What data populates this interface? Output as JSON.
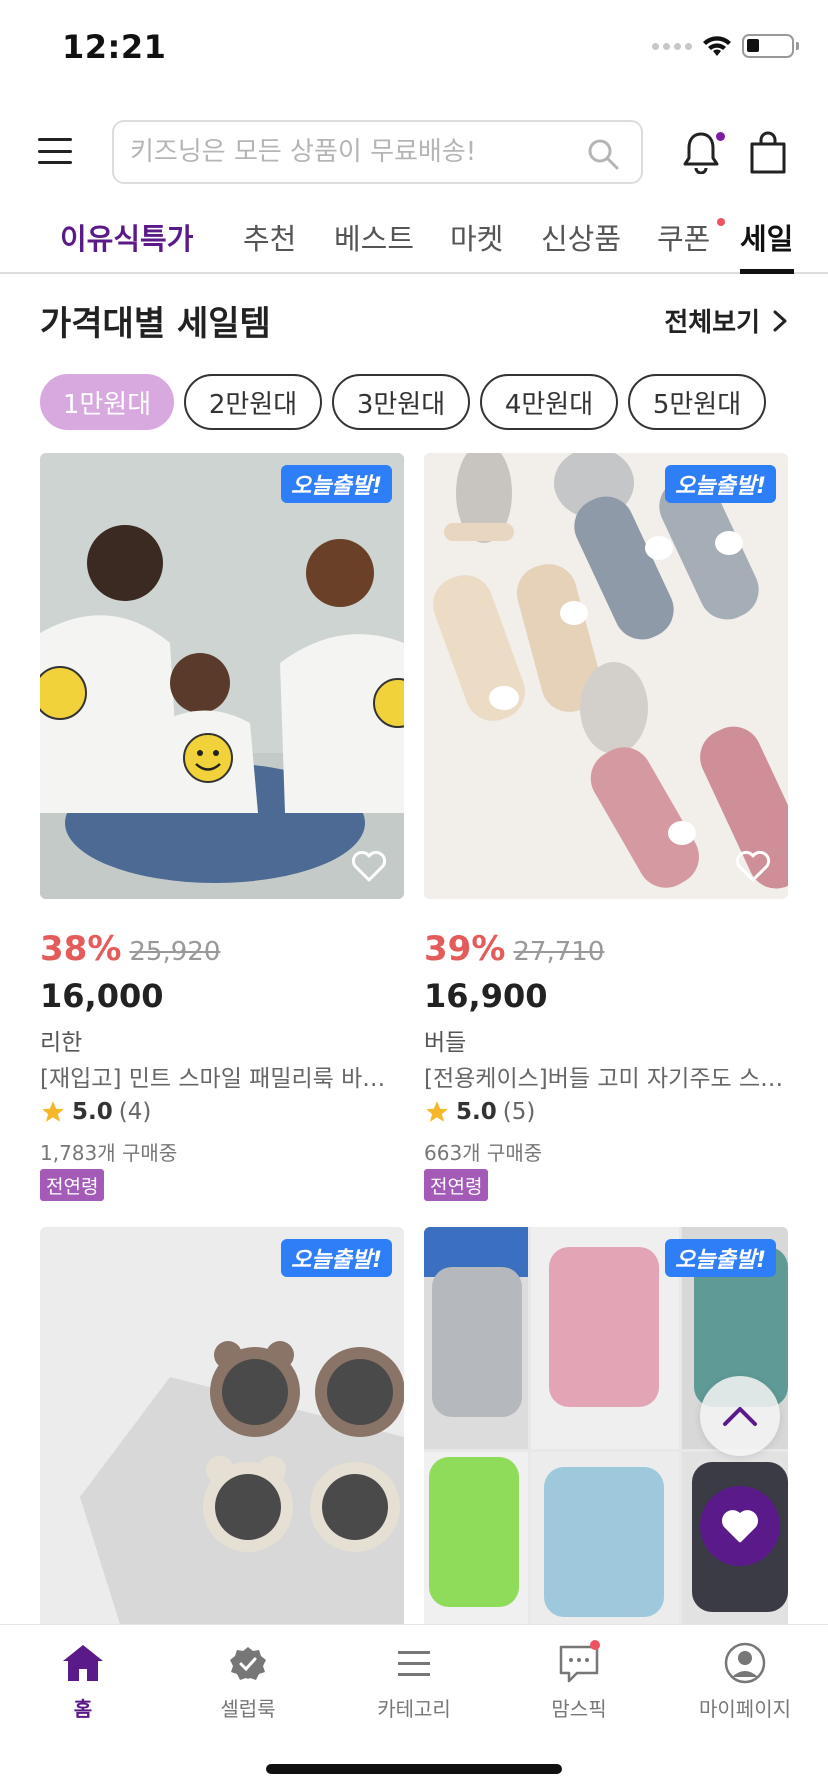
{
  "status_bar": {
    "time": "12:21"
  },
  "header": {
    "search_placeholder": "키즈닝은 모든 상품이 무료배송!"
  },
  "tabs": [
    {
      "label": "이유식특가"
    },
    {
      "label": "추천"
    },
    {
      "label": "베스트"
    },
    {
      "label": "마켓"
    },
    {
      "label": "신상품"
    },
    {
      "label": "쿠폰"
    },
    {
      "label": "세일"
    }
  ],
  "section": {
    "title": "가격대별 세일템",
    "view_all": "전체보기"
  },
  "price_chips": [
    {
      "label": "1만원대",
      "selected": true
    },
    {
      "label": "2만원대",
      "selected": false
    },
    {
      "label": "3만원대",
      "selected": false
    },
    {
      "label": "4만원대",
      "selected": false
    },
    {
      "label": "5만원대",
      "selected": false
    }
  ],
  "products": [
    {
      "badge": "오늘출발!",
      "discount": "38%",
      "original_price": "25,920",
      "price": "16,000",
      "brand": "리한",
      "name": "[재입고] 민트 스마일 패밀리룩 바캉스 …",
      "rating": "5.0",
      "review_count": "(4)",
      "buyers": "1,783개 구매중",
      "age": "전연령"
    },
    {
      "badge": "오늘출발!",
      "discount": "39%",
      "original_price": "27,710",
      "price": "16,900",
      "brand": "버들",
      "name": "[전용케이스]버들 고미 자기주도 스푼 …",
      "rating": "5.0",
      "review_count": "(5)",
      "buyers": "663개 구매중",
      "age": "전연령"
    },
    {
      "badge": "오늘출발!"
    },
    {
      "badge": "오늘출발!"
    }
  ],
  "bottom_nav": [
    {
      "label": "홈",
      "icon": "home-icon",
      "active": true
    },
    {
      "label": "셀럽룩",
      "icon": "verified-badge-icon"
    },
    {
      "label": "카테고리",
      "icon": "list-icon"
    },
    {
      "label": "맘스픽",
      "icon": "chat-bubble-icon"
    },
    {
      "label": "마이페이지",
      "icon": "profile-icon"
    }
  ],
  "colors": {
    "brand_purple": "#5b1a8a",
    "chip_active": "#d7a9df",
    "discount_red": "#e45b5b",
    "badge_blue": "#2d7ef7",
    "age_badge": "#a45bb8"
  }
}
